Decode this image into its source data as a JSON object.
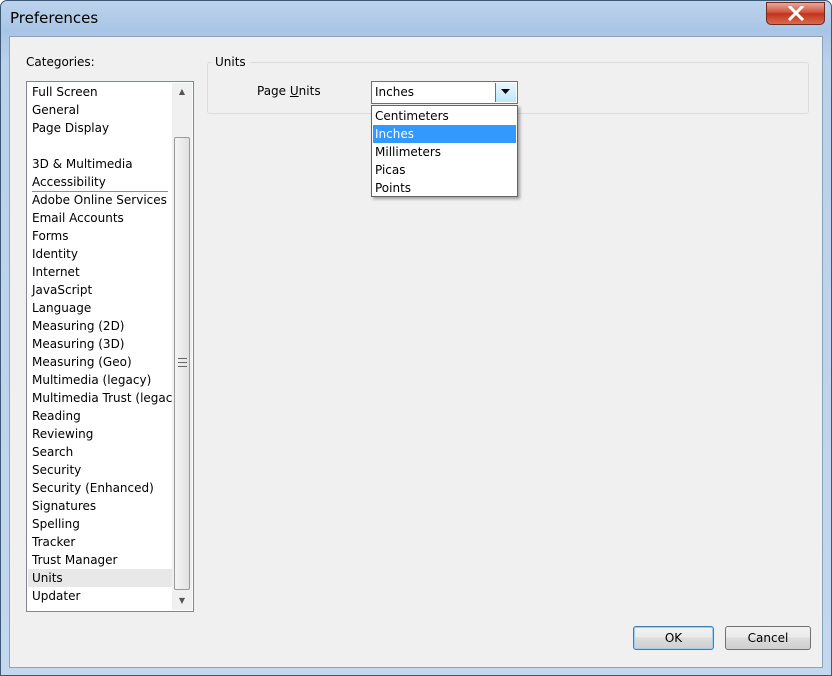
{
  "window": {
    "title": "Preferences"
  },
  "categories": {
    "label": "Categories:",
    "top_items": [
      "Full Screen",
      "General",
      "Page Display"
    ],
    "items": [
      "3D & Multimedia",
      "Accessibility",
      "Adobe Online Services",
      "Email Accounts",
      "Forms",
      "Identity",
      "Internet",
      "JavaScript",
      "Language",
      "Measuring (2D)",
      "Measuring (3D)",
      "Measuring (Geo)",
      "Multimedia (legacy)",
      "Multimedia Trust (legacy)",
      "Reading",
      "Reviewing",
      "Search",
      "Security",
      "Security (Enhanced)",
      "Signatures",
      "Spelling",
      "Tracker",
      "Trust Manager",
      "Units",
      "Updater"
    ],
    "selected": "Units"
  },
  "units": {
    "group_title": "Units",
    "page_units_label_pre": "Page ",
    "page_units_label_accel": "U",
    "page_units_label_post": "nits",
    "selected_value": "Inches",
    "options": [
      "Centimeters",
      "Inches",
      "Millimeters",
      "Picas",
      "Points"
    ],
    "highlighted": "Inches"
  },
  "buttons": {
    "ok": "OK",
    "cancel": "Cancel"
  },
  "colors": {
    "highlight": "#3399ff",
    "selected_row": "#e8e8e8",
    "close_button": "#c2331b"
  }
}
